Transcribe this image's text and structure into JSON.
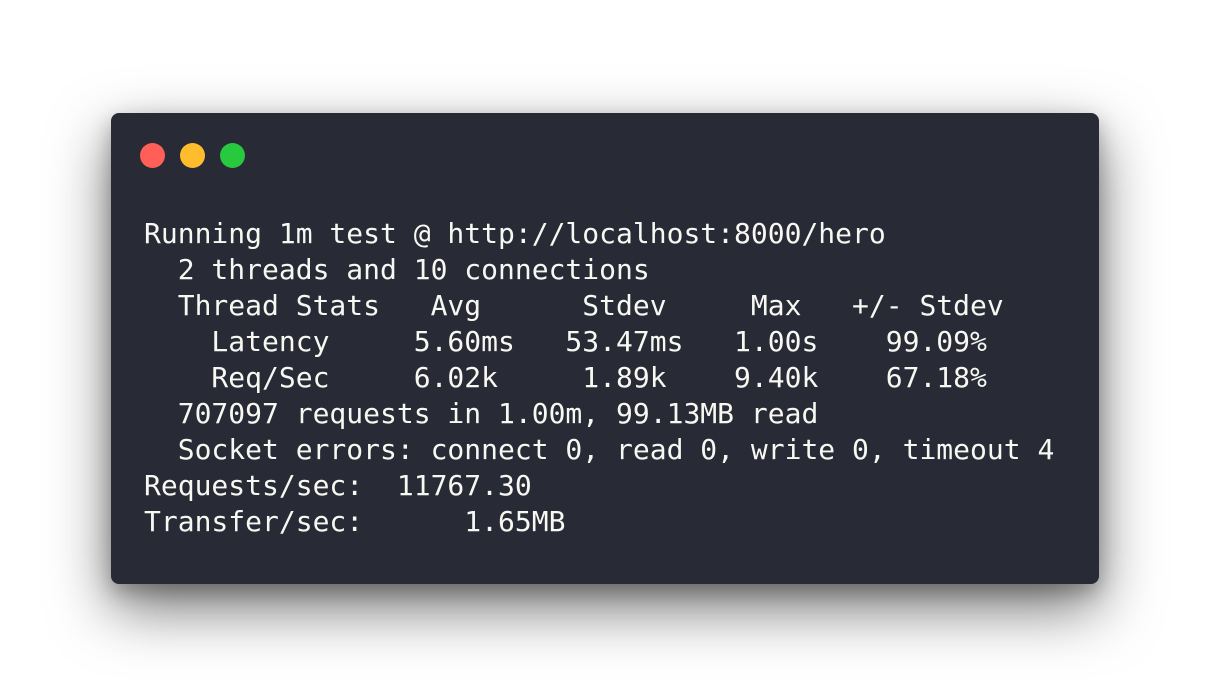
{
  "window": {
    "buttons": {
      "close": {
        "name": "close",
        "color": "#ff5f56"
      },
      "minimize": {
        "name": "minimize",
        "color": "#ffbd2e"
      },
      "maximize": {
        "name": "maximize",
        "color": "#27c93f"
      }
    }
  },
  "terminal": {
    "background": "#282a36",
    "foreground": "#f8f8f2",
    "lines": [
      "Running 1m test @ http://localhost:8000/hero",
      "  2 threads and 10 connections",
      "  Thread Stats   Avg      Stdev     Max   +/- Stdev",
      "    Latency     5.60ms   53.47ms   1.00s    99.09%",
      "    Req/Sec     6.02k     1.89k    9.40k    67.18%",
      "  707097 requests in 1.00m, 99.13MB read",
      "  Socket errors: connect 0, read 0, write 0, timeout 4",
      "Requests/sec:  11767.30",
      "Transfer/sec:      1.65MB"
    ]
  }
}
